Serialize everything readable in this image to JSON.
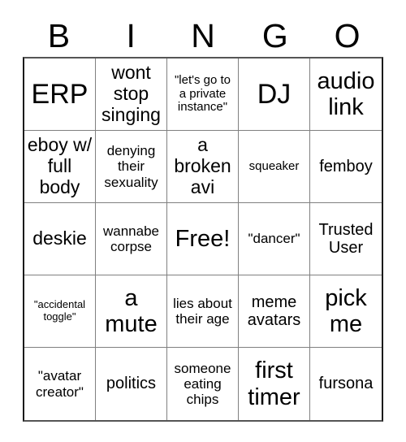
{
  "header": {
    "letters": [
      "B",
      "I",
      "N",
      "G",
      "O"
    ]
  },
  "grid": {
    "rows": 5,
    "columns": 5,
    "cells": [
      {
        "text": "ERP",
        "size": "s-xxl"
      },
      {
        "text": "wont stop singing",
        "size": "s-lg"
      },
      {
        "text": "\"let's go to a private instance\"",
        "size": "s-xs"
      },
      {
        "text": "DJ",
        "size": "s-xxl"
      },
      {
        "text": "audio link",
        "size": "s-xl"
      },
      {
        "text": "eboy w/ full body",
        "size": "s-lg"
      },
      {
        "text": "denying their sexuality",
        "size": "s-sm"
      },
      {
        "text": "a broken avi",
        "size": "s-lg"
      },
      {
        "text": "squeaker",
        "size": "s-xs"
      },
      {
        "text": "femboy",
        "size": "s-md"
      },
      {
        "text": "deskie",
        "size": "s-lg"
      },
      {
        "text": "wannabe corpse",
        "size": "s-sm"
      },
      {
        "text": "Free!",
        "size": "s-xl"
      },
      {
        "text": "\"dancer\"",
        "size": "s-sm"
      },
      {
        "text": "Trusted User",
        "size": "s-md"
      },
      {
        "text": "\"accidental toggle\"",
        "size": "s-xxs"
      },
      {
        "text": "a mute",
        "size": "s-xl"
      },
      {
        "text": "lies about their age",
        "size": "s-sm"
      },
      {
        "text": "meme avatars",
        "size": "s-md"
      },
      {
        "text": "pick me",
        "size": "s-xl"
      },
      {
        "text": "\"avatar creator\"",
        "size": "s-sm"
      },
      {
        "text": "politics",
        "size": "s-md"
      },
      {
        "text": "someone eating chips",
        "size": "s-sm"
      },
      {
        "text": "first timer",
        "size": "s-xl"
      },
      {
        "text": "fursona",
        "size": "s-md"
      }
    ]
  }
}
